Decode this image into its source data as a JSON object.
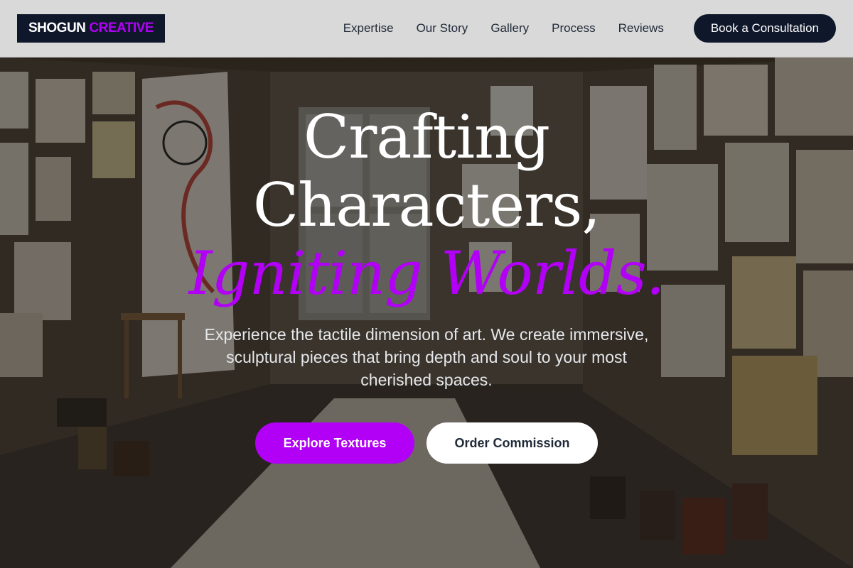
{
  "header": {
    "logo_part1": "SHOGUN",
    "logo_part2": "CREATIVE",
    "nav": [
      {
        "label": "Expertise"
      },
      {
        "label": "Our Story"
      },
      {
        "label": "Gallery"
      },
      {
        "label": "Process"
      },
      {
        "label": "Reviews"
      }
    ],
    "cta_label": "Book a Consultation"
  },
  "hero": {
    "title_line1": "Crafting",
    "title_line2": "Characters,",
    "title_line3": "Igniting Worlds.",
    "subtitle": "Experience the tactile dimension of art. We create immersive, sculptural pieces that bring depth and soul to your most cherished spaces.",
    "primary_button": "Explore Textures",
    "secondary_button": "Order Commission",
    "background_image": "art-studio-photo"
  },
  "colors": {
    "accent": "#b100f5",
    "navy": "#0f172a",
    "header_bg": "#d9d9d9"
  }
}
